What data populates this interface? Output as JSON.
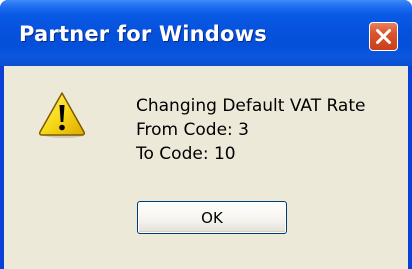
{
  "window": {
    "title": "Partner for Windows"
  },
  "dialog": {
    "icon": "warning-icon",
    "message_lines": [
      "Changing Default VAT Rate",
      "From Code: 3",
      "To Code: 10"
    ],
    "ok_label": "OK"
  },
  "colors": {
    "titlebar": "#0652dd",
    "client_background": "#ece9d8",
    "close_button": "#d9532c",
    "warning_yellow": "#f5d000"
  }
}
